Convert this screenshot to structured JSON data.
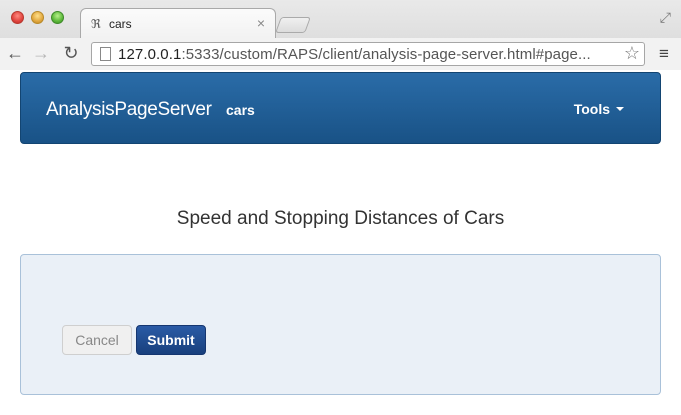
{
  "browser": {
    "tab_title": "cars",
    "url_host": "127.0.0.1",
    "url_rest": ":5333/custom/RAPS/client/analysis-page-server.html#page..."
  },
  "navbar": {
    "brand": "AnalysisPageServer",
    "subtitle": "cars",
    "tools_label": "Tools"
  },
  "main": {
    "heading": "Speed and Stopping Distances of Cars",
    "cancel_label": "Cancel",
    "submit_label": "Submit"
  },
  "colors": {
    "navbar_bg": "#1f5f99",
    "panel_bg": "#eaf0f7",
    "submit_bg": "#214d93"
  }
}
